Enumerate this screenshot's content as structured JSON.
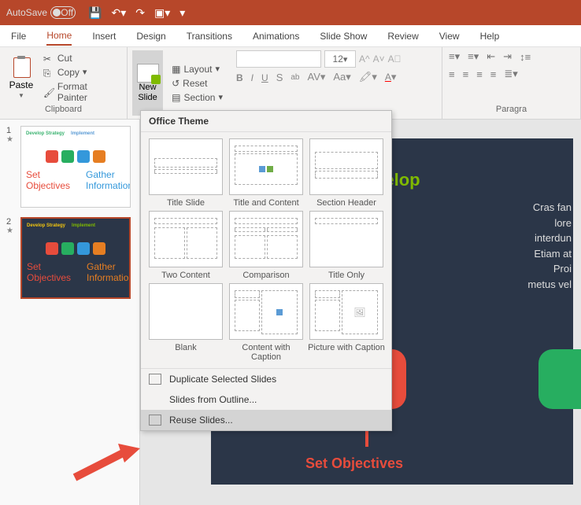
{
  "titlebar": {
    "autosave_label": "AutoSave",
    "autosave_state": "Off"
  },
  "tabs": [
    "File",
    "Home",
    "Insert",
    "Design",
    "Transitions",
    "Animations",
    "Slide Show",
    "Review",
    "View",
    "Help"
  ],
  "active_tab": "Home",
  "clipboard": {
    "paste": "Paste",
    "cut": "Cut",
    "copy": "Copy",
    "format_painter": "Format Painter",
    "group_label": "Clipboard"
  },
  "slides_group": {
    "new_slide": "New\nSlide",
    "layout": "Layout",
    "reset": "Reset",
    "section": "Section"
  },
  "font": {
    "size": "12",
    "group_label": "Paragra"
  },
  "dropdown": {
    "header": "Office Theme",
    "layouts": [
      "Title Slide",
      "Title and Content",
      "Section Header",
      "Two Content",
      "Comparison",
      "Title Only",
      "Blank",
      "Content with Caption",
      "Picture with Caption"
    ],
    "items": [
      "Duplicate Selected Slides",
      "Slides from Outline...",
      "Reuse Slides..."
    ]
  },
  "thumbs": [
    {
      "num": "1"
    },
    {
      "num": "2"
    }
  ],
  "slide": {
    "title": "Develop",
    "body": "Cras fan\nlore\ninterdun\nEtiam at\nProi\nmetus vel",
    "obj": "Set Objectives"
  }
}
